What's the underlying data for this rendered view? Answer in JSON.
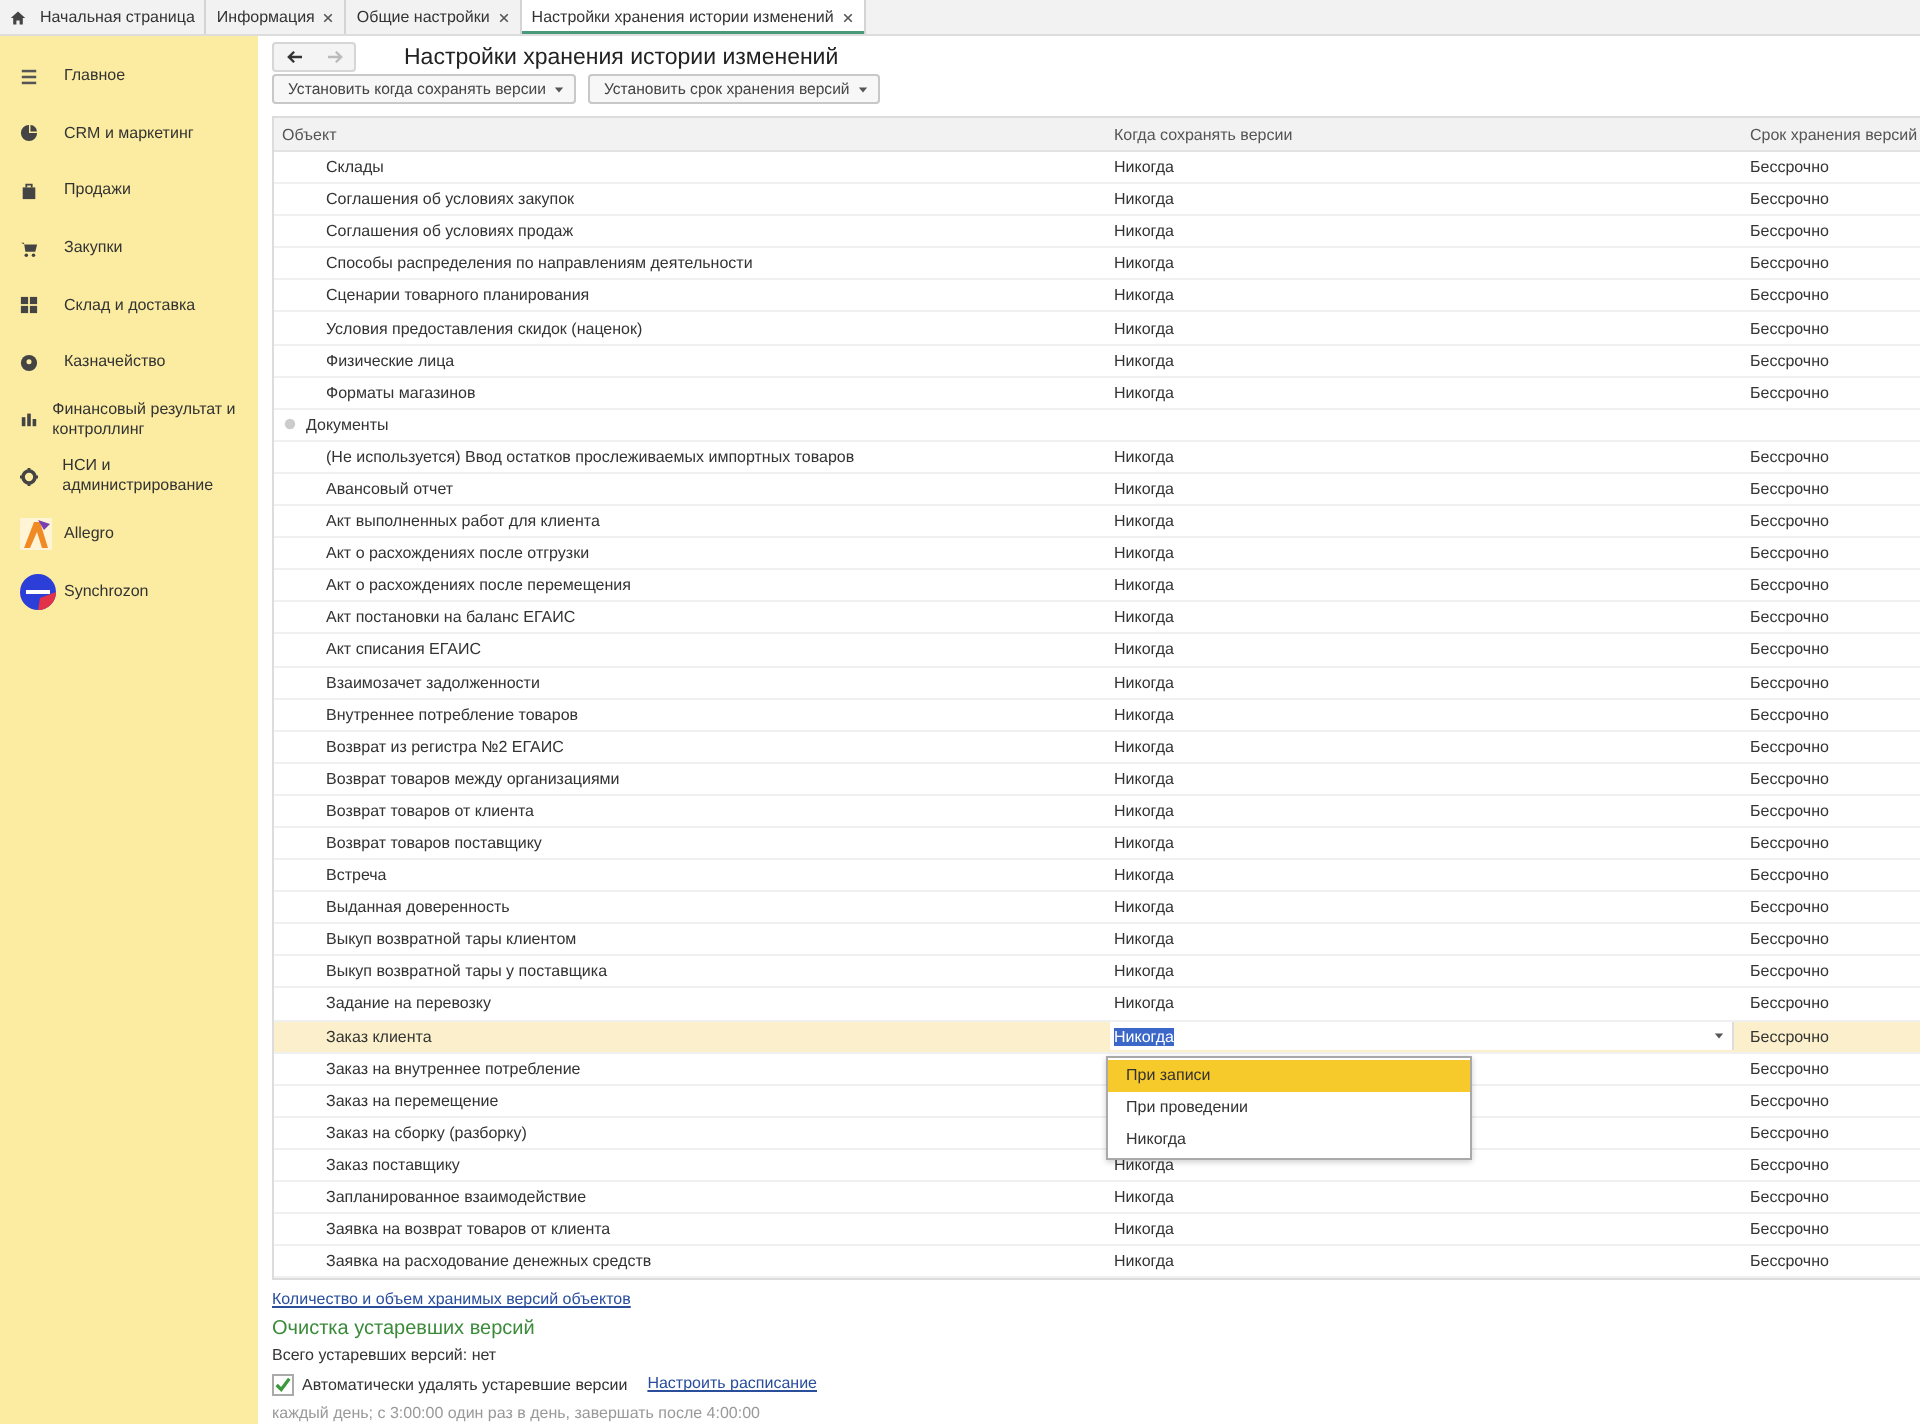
{
  "tabs": [
    {
      "label": "Начальная страница",
      "kind": "home",
      "selected": false
    },
    {
      "label": "Информация",
      "kind": "doc",
      "selected": false
    },
    {
      "label": "Общие настройки",
      "kind": "doc",
      "selected": false
    },
    {
      "label": "Настройки хранения истории изменений",
      "kind": "doc",
      "selected": true
    }
  ],
  "sidebar": {
    "items": [
      {
        "label": "Главное",
        "kind": "menu"
      },
      {
        "label": "CRM и маркетинг",
        "kind": "pie"
      },
      {
        "label": "Продажи",
        "kind": "bag"
      },
      {
        "label": "Закупки",
        "kind": "cart"
      },
      {
        "label": "Склад и доставка",
        "kind": "grid"
      },
      {
        "label": "Казначейство",
        "kind": "coin"
      },
      {
        "label": "Финансовый результат и контроллинг",
        "kind": "bars"
      },
      {
        "label": "НСИ и администрирование",
        "kind": "gear"
      },
      {
        "label": "Allegro",
        "kind": "logo-a"
      },
      {
        "label": "Synchrozon",
        "kind": "logo-b"
      }
    ]
  },
  "nav": [
    {
      "kind": "back",
      "disabled": false
    },
    {
      "kind": "forward",
      "disabled": true
    }
  ],
  "title": "Настройки хранения истории изменений",
  "toolbar": [
    "Установить когда сохранять версии",
    "Установить срок хранения версий"
  ],
  "table": {
    "columns": [
      "Объект",
      "Когда сохранять версии",
      "Срок хранения версий"
    ],
    "rows": [
      {
        "kind": "item",
        "object": "Склады",
        "when": "Никогда",
        "term": "Бессрочно",
        "selected": false
      },
      {
        "kind": "item",
        "object": "Соглашения об условиях закупок",
        "when": "Никогда",
        "term": "Бессрочно",
        "selected": false
      },
      {
        "kind": "item",
        "object": "Соглашения об условиях продаж",
        "when": "Никогда",
        "term": "Бессрочно",
        "selected": false
      },
      {
        "kind": "item",
        "object": "Способы распределения по направлениям деятельности",
        "when": "Никогда",
        "term": "Бессрочно",
        "selected": false
      },
      {
        "kind": "item",
        "object": "Сценарии товарного планирования",
        "when": "Никогда",
        "term": "Бессрочно",
        "selected": false
      },
      {
        "kind": "item",
        "object": "Условия предоставления скидок (наценок)",
        "when": "Никогда",
        "term": "Бессрочно",
        "selected": false
      },
      {
        "kind": "item",
        "object": "Физические лица",
        "when": "Никогда",
        "term": "Бессрочно",
        "selected": false
      },
      {
        "kind": "item",
        "object": "Форматы магазинов",
        "when": "Никогда",
        "term": "Бессрочно",
        "selected": false
      },
      {
        "kind": "group",
        "object": "Документы",
        "selected": false
      },
      {
        "kind": "item",
        "object": "(Не используется) Ввод остатков прослеживаемых импортных товаров",
        "when": "Никогда",
        "term": "Бессрочно",
        "selected": false
      },
      {
        "kind": "item",
        "object": "Авансовый отчет",
        "when": "Никогда",
        "term": "Бессрочно",
        "selected": false
      },
      {
        "kind": "item",
        "object": "Акт выполненных работ для клиента",
        "when": "Никогда",
        "term": "Бессрочно",
        "selected": false
      },
      {
        "kind": "item",
        "object": "Акт о расхождениях после отгрузки",
        "when": "Никогда",
        "term": "Бессрочно",
        "selected": false
      },
      {
        "kind": "item",
        "object": "Акт о расхождениях после перемещения",
        "when": "Никогда",
        "term": "Бессрочно",
        "selected": false
      },
      {
        "kind": "item",
        "object": "Акт постановки на баланс ЕГАИС",
        "when": "Никогда",
        "term": "Бессрочно",
        "selected": false
      },
      {
        "kind": "item",
        "object": "Акт списания ЕГАИС",
        "when": "Никогда",
        "term": "Бессрочно",
        "selected": false
      },
      {
        "kind": "item",
        "object": "Взаимозачет задолженности",
        "when": "Никогда",
        "term": "Бессрочно",
        "selected": false
      },
      {
        "kind": "item",
        "object": "Внутреннее потребление товаров",
        "when": "Никогда",
        "term": "Бессрочно",
        "selected": false
      },
      {
        "kind": "item",
        "object": "Возврат из регистра №2 ЕГАИС",
        "when": "Никогда",
        "term": "Бессрочно",
        "selected": false
      },
      {
        "kind": "item",
        "object": "Возврат товаров между организациями",
        "when": "Никогда",
        "term": "Бессрочно",
        "selected": false
      },
      {
        "kind": "item",
        "object": "Возврат товаров от клиента",
        "when": "Никогда",
        "term": "Бессрочно",
        "selected": false
      },
      {
        "kind": "item",
        "object": "Возврат товаров поставщику",
        "when": "Никогда",
        "term": "Бессрочно",
        "selected": false
      },
      {
        "kind": "item",
        "object": "Встреча",
        "when": "Никогда",
        "term": "Бессрочно",
        "selected": false
      },
      {
        "kind": "item",
        "object": "Выданная доверенность",
        "when": "Никогда",
        "term": "Бессрочно",
        "selected": false
      },
      {
        "kind": "item",
        "object": "Выкуп возвратной тары клиентом",
        "when": "Никогда",
        "term": "Бессрочно",
        "selected": false
      },
      {
        "kind": "item",
        "object": "Выкуп возвратной тары у поставщика",
        "when": "Никогда",
        "term": "Бессрочно",
        "selected": false
      },
      {
        "kind": "item",
        "object": "Задание на перевозку",
        "when": "Никогда",
        "term": "Бессрочно",
        "selected": false
      },
      {
        "kind": "item",
        "object": "Заказ клиента",
        "when": "Никогда",
        "term": "Бессрочно",
        "selected": true
      },
      {
        "kind": "item",
        "object": "Заказ на внутреннее потребление",
        "term": "Бессрочно",
        "selected": false
      },
      {
        "kind": "item",
        "object": "Заказ на перемещение",
        "term": "Бессрочно",
        "selected": false
      },
      {
        "kind": "item",
        "object": "Заказ на сборку (разборку)",
        "term": "Бессрочно",
        "selected": false
      },
      {
        "kind": "item",
        "object": "Заказ поставщику",
        "when": "Никогда",
        "term": "Бессрочно",
        "selected": false
      },
      {
        "kind": "item",
        "object": "Запланированное взаимодействие",
        "when": "Никогда",
        "term": "Бессрочно",
        "selected": false
      },
      {
        "kind": "item",
        "object": "Заявка на возврат товаров от клиента",
        "when": "Никогда",
        "term": "Бессрочно",
        "selected": false
      },
      {
        "kind": "item",
        "object": "Заявка на расходование денежных средств",
        "when": "Никогда",
        "term": "Бессрочно",
        "selected": false
      }
    ]
  },
  "dropdown": [
    {
      "label": "При записи",
      "selected": true
    },
    {
      "label": "При проведении",
      "selected": false
    },
    {
      "label": "Никогда",
      "selected": false
    }
  ],
  "link": "Количество и объем хранимых версий объектов",
  "cleanup": {
    "heading": "Очистка устаревших версий",
    "total": "Всего устаревших версий: нет",
    "auto_delete": {
      "label": "Автоматически удалять устаревшие версии",
      "checked": true
    },
    "schedule_link": "Настроить расписание",
    "schedule": "каждый день; с 3:00:00 один раз в день, завершать после 4:00:00"
  }
}
